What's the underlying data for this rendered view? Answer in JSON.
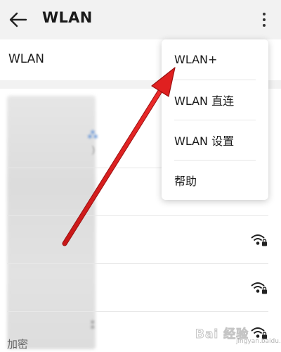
{
  "header": {
    "title": "WLAN",
    "back_icon": "arrow-left-icon",
    "overflow_icon": "more-vertical-icon"
  },
  "wlan_row": {
    "label": "WLAN"
  },
  "menu": {
    "items": [
      {
        "label": "WLAN+"
      },
      {
        "label": "WLAN 直连"
      },
      {
        "label": "WLAN 设置"
      },
      {
        "label": "帮助"
      }
    ]
  },
  "network_list": {
    "secured_icon": "wifi-lock-icon",
    "footer_text": "加密"
  },
  "annotation": {
    "color": "#e02020"
  },
  "watermark": {
    "text": "Bai 经验",
    "sub": "jingyan.baidu.com"
  },
  "colors": {
    "background": "#f2f2f2",
    "surface": "#ffffff",
    "annotation_arrow": "#e02020"
  }
}
